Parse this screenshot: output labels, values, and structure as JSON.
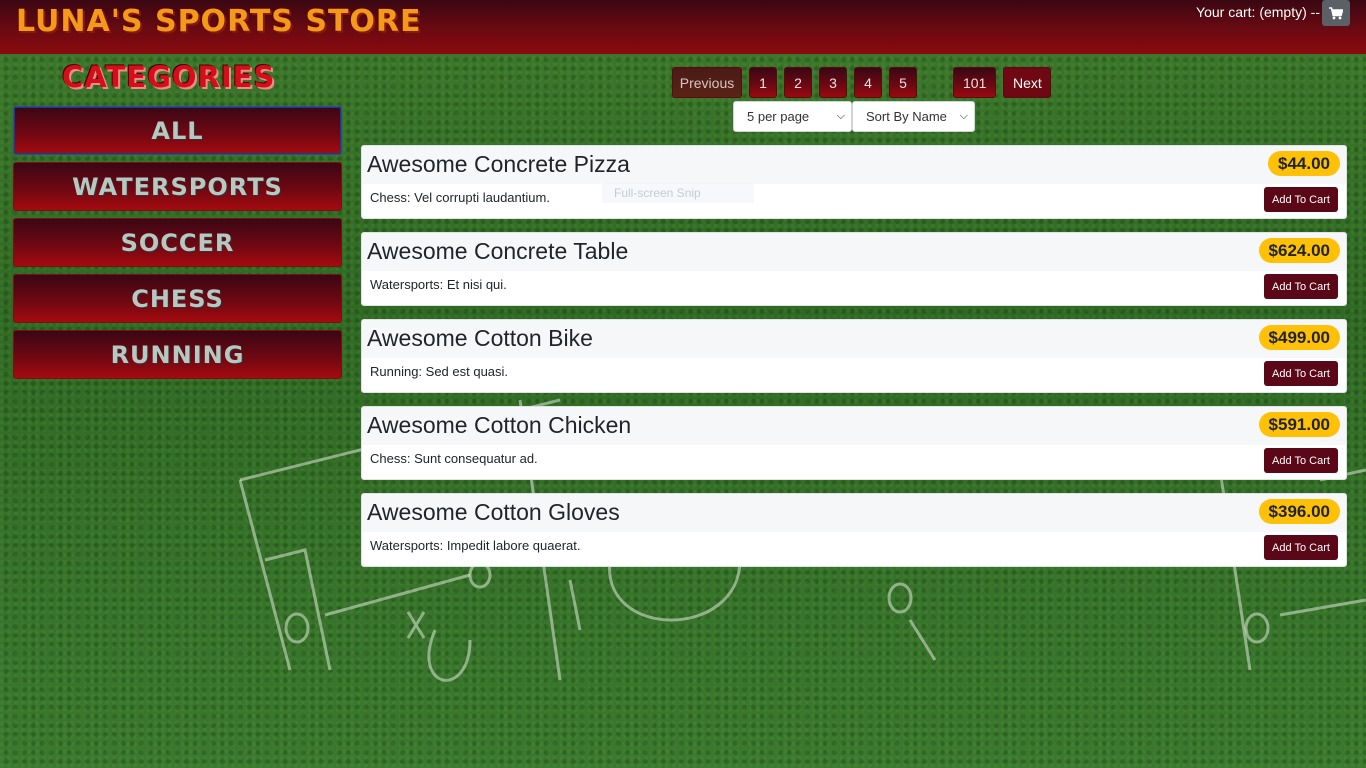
{
  "header": {
    "brand": "LUNA'S SPORTS STORE",
    "cart_label": "Your cart: (empty) --",
    "cart_icon": "cart-icon"
  },
  "sidebar": {
    "title": "CATEGORIES",
    "items": [
      {
        "label": "ALL",
        "active": true
      },
      {
        "label": "WATERSPORTS",
        "active": false
      },
      {
        "label": "SOCCER",
        "active": false
      },
      {
        "label": "CHESS",
        "active": false
      },
      {
        "label": "RUNNING",
        "active": false
      }
    ]
  },
  "pagination": {
    "previous": "Previous",
    "pages": [
      "1",
      "2",
      "3",
      "4",
      "5"
    ],
    "last_page": "101",
    "next": "Next"
  },
  "filters": {
    "per_page": "5 per page",
    "sort": "Sort By Name"
  },
  "products": [
    {
      "name": "Awesome Concrete Pizza",
      "price": "$44.00",
      "description": "Chess: Vel corrupti laudantium.",
      "button": "Add To Cart"
    },
    {
      "name": "Awesome Concrete Table",
      "price": "$624.00",
      "description": "Watersports: Et nisi qui.",
      "button": "Add To Cart"
    },
    {
      "name": "Awesome Cotton Bike",
      "price": "$499.00",
      "description": "Running: Sed est quasi.",
      "button": "Add To Cart"
    },
    {
      "name": "Awesome Cotton Chicken",
      "price": "$591.00",
      "description": "Chess: Sunt consequatur ad.",
      "button": "Add To Cart"
    },
    {
      "name": "Awesome Cotton Gloves",
      "price": "$396.00",
      "description": "Watersports: Impedit labore quaerat.",
      "button": "Add To Cart"
    }
  ],
  "overlay": {
    "tooltip": "Full-screen Snip"
  },
  "colors": {
    "header_bg": "#6b0a12",
    "brand": "#f39a1b",
    "category_title": "#d40f19",
    "price_badge": "#ffc107",
    "add_button": "#5a0818"
  }
}
